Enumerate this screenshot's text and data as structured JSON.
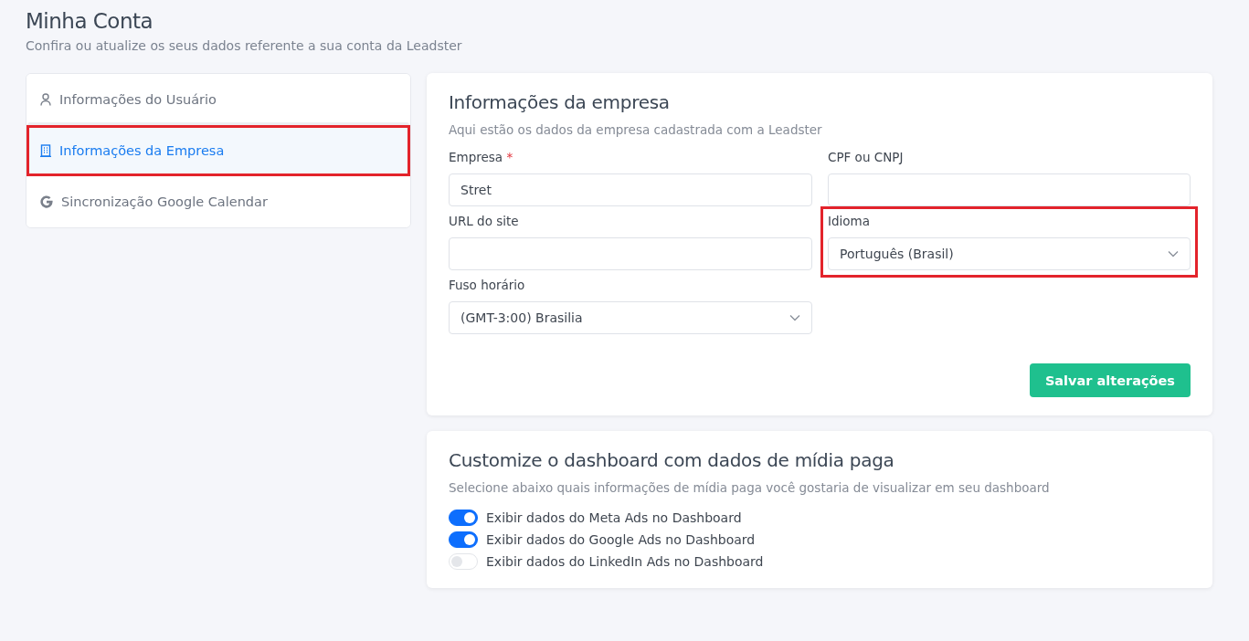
{
  "header": {
    "title": "Minha Conta",
    "subtitle": "Confira ou atualize os seus dados referente a sua conta da Leadster"
  },
  "sidebar": {
    "items": [
      {
        "kind": "user",
        "label": "Informações do Usuário",
        "selected": false,
        "highlighted": false
      },
      {
        "kind": "building",
        "label": "Informações da Empresa",
        "selected": true,
        "highlighted": true
      },
      {
        "kind": "google",
        "label": "Sincronização Google Calendar",
        "selected": false,
        "highlighted": false
      }
    ]
  },
  "company_card": {
    "title": "Informações da empresa",
    "subtitle": "Aqui estão os dados da empresa cadastrada com a Leadster",
    "fields": [
      {
        "kind": "text",
        "label": "Empresa",
        "required_mark": "*",
        "value": "Stret"
      },
      {
        "kind": "text",
        "label": "CPF ou CNPJ"
      },
      {
        "kind": "text",
        "label": "URL do site"
      },
      {
        "kind": "select",
        "label": "Idioma",
        "value": "Português (Brasil)",
        "highlighted": true
      },
      {
        "kind": "select",
        "label": "Fuso horário",
        "value": "(GMT-3:00) Brasilia"
      }
    ],
    "save_button": "Salvar alterações"
  },
  "media_card": {
    "title": "Customize o dashboard com dados de mídia paga",
    "subtitle": "Selecione abaixo quais informações de mídia paga você gostaria de visualizar em seu dashboard",
    "toggles": [
      {
        "label": "Exibir dados do Meta Ads no Dashboard",
        "on": true
      },
      {
        "label": "Exibir dados do Google Ads no Dashboard",
        "on": true
      },
      {
        "label": "Exibir dados do LinkedIn Ads no Dashboard",
        "on": false
      }
    ]
  }
}
